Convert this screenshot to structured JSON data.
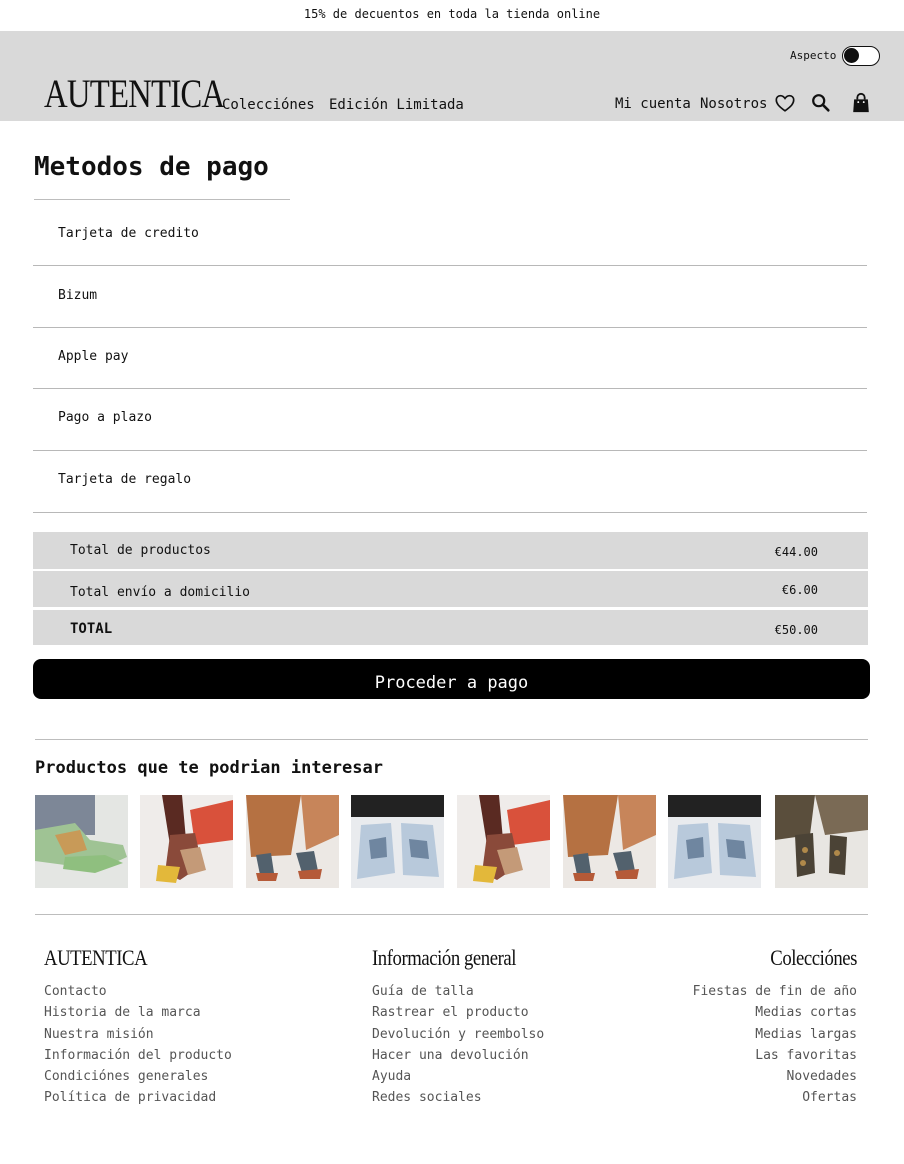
{
  "promo": {
    "text": "15% de decuentos en toda la tienda online"
  },
  "header": {
    "logo": "AUTENTICA",
    "nav": [
      "Colecciónes",
      "Edición Limitada"
    ],
    "aspect_label": "Aspecto",
    "account": "Mi cuenta",
    "about": "Nosotros"
  },
  "payment": {
    "title": "Metodos de pago",
    "methods": [
      "Tarjeta de credito",
      "Bizum",
      "Apple pay",
      "Pago a plazo",
      "Tarjeta de regalo"
    ]
  },
  "summary": {
    "rows": [
      {
        "label": "Total de productos",
        "value": "€44.00"
      },
      {
        "label": "Total envío a domicilio",
        "value": "€6.00"
      },
      {
        "label": "TOTAL",
        "value": "€50.00"
      }
    ],
    "button": "Proceder a pago"
  },
  "recommended": {
    "title": "Productos que te podrian interesar"
  },
  "footer": {
    "brand": {
      "title": "AUTENTICA",
      "links": [
        "Contacto",
        "Historia de la marca",
        "Nuestra misión",
        "Información del producto",
        "Condiciónes generales",
        "Política de privacidad"
      ]
    },
    "info": {
      "title": "Información general",
      "links": [
        "Guía de talla",
        "Rastrear el producto",
        "Devolución y reembolso",
        "Hacer una devolución",
        "Ayuda",
        "Redes sociales"
      ]
    },
    "collections": {
      "title": "Colecciónes",
      "links": [
        "Fiestas de fin de año",
        "Medias cortas",
        "Medias largas",
        "Las favoritas",
        "Novedades",
        "Ofertas"
      ]
    }
  },
  "colors": {
    "header_bg": "#d9d9d9",
    "button_bg": "#000000",
    "accent": "#111111"
  }
}
